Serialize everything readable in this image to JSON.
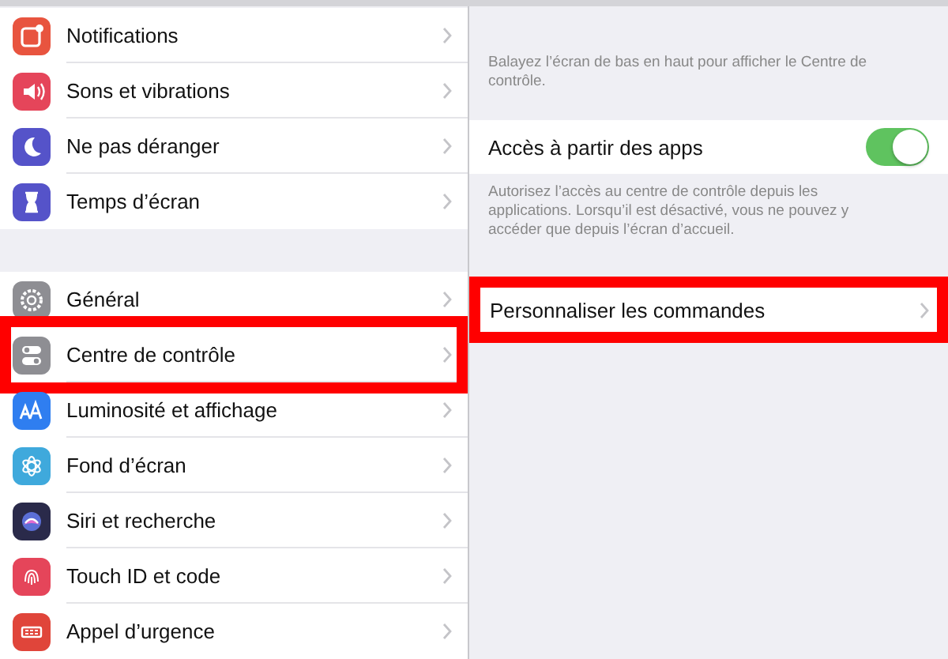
{
  "sidebar": {
    "groups": [
      {
        "items": [
          {
            "label": "Notifications",
            "color": "#e8543f",
            "highlighted": false
          },
          {
            "label": "Sons et vibrations",
            "color": "#e5455a",
            "highlighted": false
          },
          {
            "label": "Ne pas déranger",
            "color": "#5553c9",
            "highlighted": false
          },
          {
            "label": "Temps d’écran",
            "color": "#5553c9",
            "highlighted": false
          }
        ]
      },
      {
        "items": [
          {
            "label": "Général",
            "color": "#8e8e93",
            "highlighted": false
          },
          {
            "label": "Centre de contrôle",
            "color": "#8e8e93",
            "highlighted": true
          },
          {
            "label": "Luminosité et affichage",
            "color": "#2f7ef0",
            "highlighted": false
          },
          {
            "label": "Fond d’écran",
            "color": "#3fa9dc",
            "highlighted": false
          },
          {
            "label": "Siri et recherche",
            "color": "#2a2a4a",
            "highlighted": false
          },
          {
            "label": "Touch ID et code",
            "color": "#e5455a",
            "highlighted": false
          },
          {
            "label": "Appel d’urgence",
            "color": "#e0453a",
            "highlighted": false
          }
        ]
      }
    ]
  },
  "detail": {
    "description": "Balayez l’écran de bas en haut pour afficher le Centre de contrôle.",
    "toggle_row": {
      "label": "Accès à partir des apps",
      "on": true
    },
    "footer": "Autorisez l’accès au centre de contrôle depuis les applications. Lorsqu’il est désactivé, vous ne pouvez y accéder que depuis l’écran d’accueil.",
    "link_row": {
      "label": "Personnaliser les commandes",
      "highlighted": true
    }
  }
}
